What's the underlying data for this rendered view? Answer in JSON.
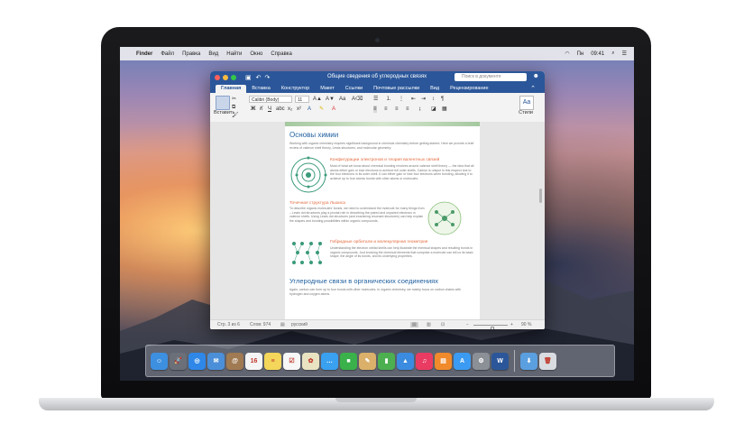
{
  "menubar": {
    "apple": "",
    "items": [
      "Finder",
      "Файл",
      "Правка",
      "Вид",
      "Найти",
      "Окно",
      "Справка"
    ],
    "status": [
      "Пн",
      "09:41"
    ]
  },
  "window": {
    "title": "Общие сведения об углеродных связях",
    "search_placeholder": "Поиск в документе",
    "tabs": [
      "Главная",
      "Вставка",
      "Конструктор",
      "Макет",
      "Ссылки",
      "Почтовые рассылки",
      "Вид",
      "Рецензирование"
    ],
    "ribbon": {
      "paste_label": "Вставить",
      "font": "Calibri (Body)",
      "size": "11",
      "styles_label": "Стили"
    }
  },
  "document": {
    "heading1": "Основы химии",
    "intro": "Working with organic chemistry requires significant background in chemical chemistry before getting started. Here we provide a brief review of valence shell theory, Lewis structures, and molecular geometry.",
    "section1_title": "Конфигурации электронов и теория валентных связей",
    "section1_text": "Most of what we know about chemical bonding revolves around valence shell theory — the idea that all atoms either gain or lose electrons to achieve full outer shells. Carbon is unique in this respect due to the four electrons in its outer shell. It can either gain or lose four electrons when bonding, allowing it to achieve up to four atomic bonds with other atoms or molecules.",
    "section2_title": "Точечная структура Льюиса",
    "section2_text": "To describe organic molecules' bonds, we need to understand the molecule for many things from – Lewis dot structures play a pivotal role in describing the paired and unpaired electrons in valence shells. Using Lewis dot structures (and examining resonant structures) can help explain the shapes and bonding possibilities within organic compounds.",
    "section3_title": "Гибридные орбитали и молекулярная геометрия",
    "section3_text": "Understanding the electron orbital shells can help illustrate the eventual shapes and resulting bonds in organic compounds. Just knowing the chemical elements that comprise a molecule can tell us its basic shape, the angle of its bonds, and its underlying properties.",
    "heading2": "Углеродные связи в органических соединениях",
    "outro": "Again, carbon can form up to four bonds with other molecules. In organic chemistry, we mainly focus on carbon chains with hydrogen and oxygen atoms."
  },
  "statusbar": {
    "page": "Стр. 3 из 6",
    "words": "Слов: 974",
    "language": "русский",
    "zoom": "90 %",
    "zoom_fraction": 0.55
  },
  "dock": {
    "icons": [
      {
        "name": "finder-icon",
        "color": "#3d8fe0",
        "glyph": "☺"
      },
      {
        "name": "launchpad-icon",
        "color": "#6b6f78",
        "glyph": "🚀"
      },
      {
        "name": "safari-icon",
        "color": "#2f87e8",
        "glyph": "◎"
      },
      {
        "name": "mail-icon",
        "color": "#4b8fd8",
        "glyph": "✉"
      },
      {
        "name": "contacts-icon",
        "color": "#a07a52",
        "glyph": "@"
      },
      {
        "name": "calendar-icon",
        "color": "#f5f5f5",
        "glyph": "16"
      },
      {
        "name": "notes-icon",
        "color": "#f3d65a",
        "glyph": "≡"
      },
      {
        "name": "reminders-icon",
        "color": "#f7f7f7",
        "glyph": "☑"
      },
      {
        "name": "photo-icon",
        "color": "#e9e3c2",
        "glyph": "✿"
      },
      {
        "name": "messages-icon",
        "color": "#3aa0f0",
        "glyph": "…"
      },
      {
        "name": "facetime-icon",
        "color": "#3ab14a",
        "glyph": "■"
      },
      {
        "name": "preview-icon",
        "color": "#dab06a",
        "glyph": "✎"
      },
      {
        "name": "numbers-icon",
        "color": "#4caf50",
        "glyph": "▮"
      },
      {
        "name": "keynote-icon",
        "color": "#3b8be0",
        "glyph": "▲"
      },
      {
        "name": "itunes-icon",
        "color": "#ea3b62",
        "glyph": "♫"
      },
      {
        "name": "ibooks-icon",
        "color": "#f08a2a",
        "glyph": "▤"
      },
      {
        "name": "app-store-icon",
        "color": "#3b9bf2",
        "glyph": "A"
      },
      {
        "name": "system-preferences-icon",
        "color": "#8b8f96",
        "glyph": "⚙"
      },
      {
        "name": "word-icon",
        "color": "#2b579a",
        "glyph": "W"
      }
    ],
    "right_icons": [
      {
        "name": "downloads-folder-icon",
        "color": "#5a9fe0",
        "glyph": "⬇"
      },
      {
        "name": "trash-icon",
        "color": "#d9dde2",
        "glyph": "🗑"
      }
    ]
  }
}
